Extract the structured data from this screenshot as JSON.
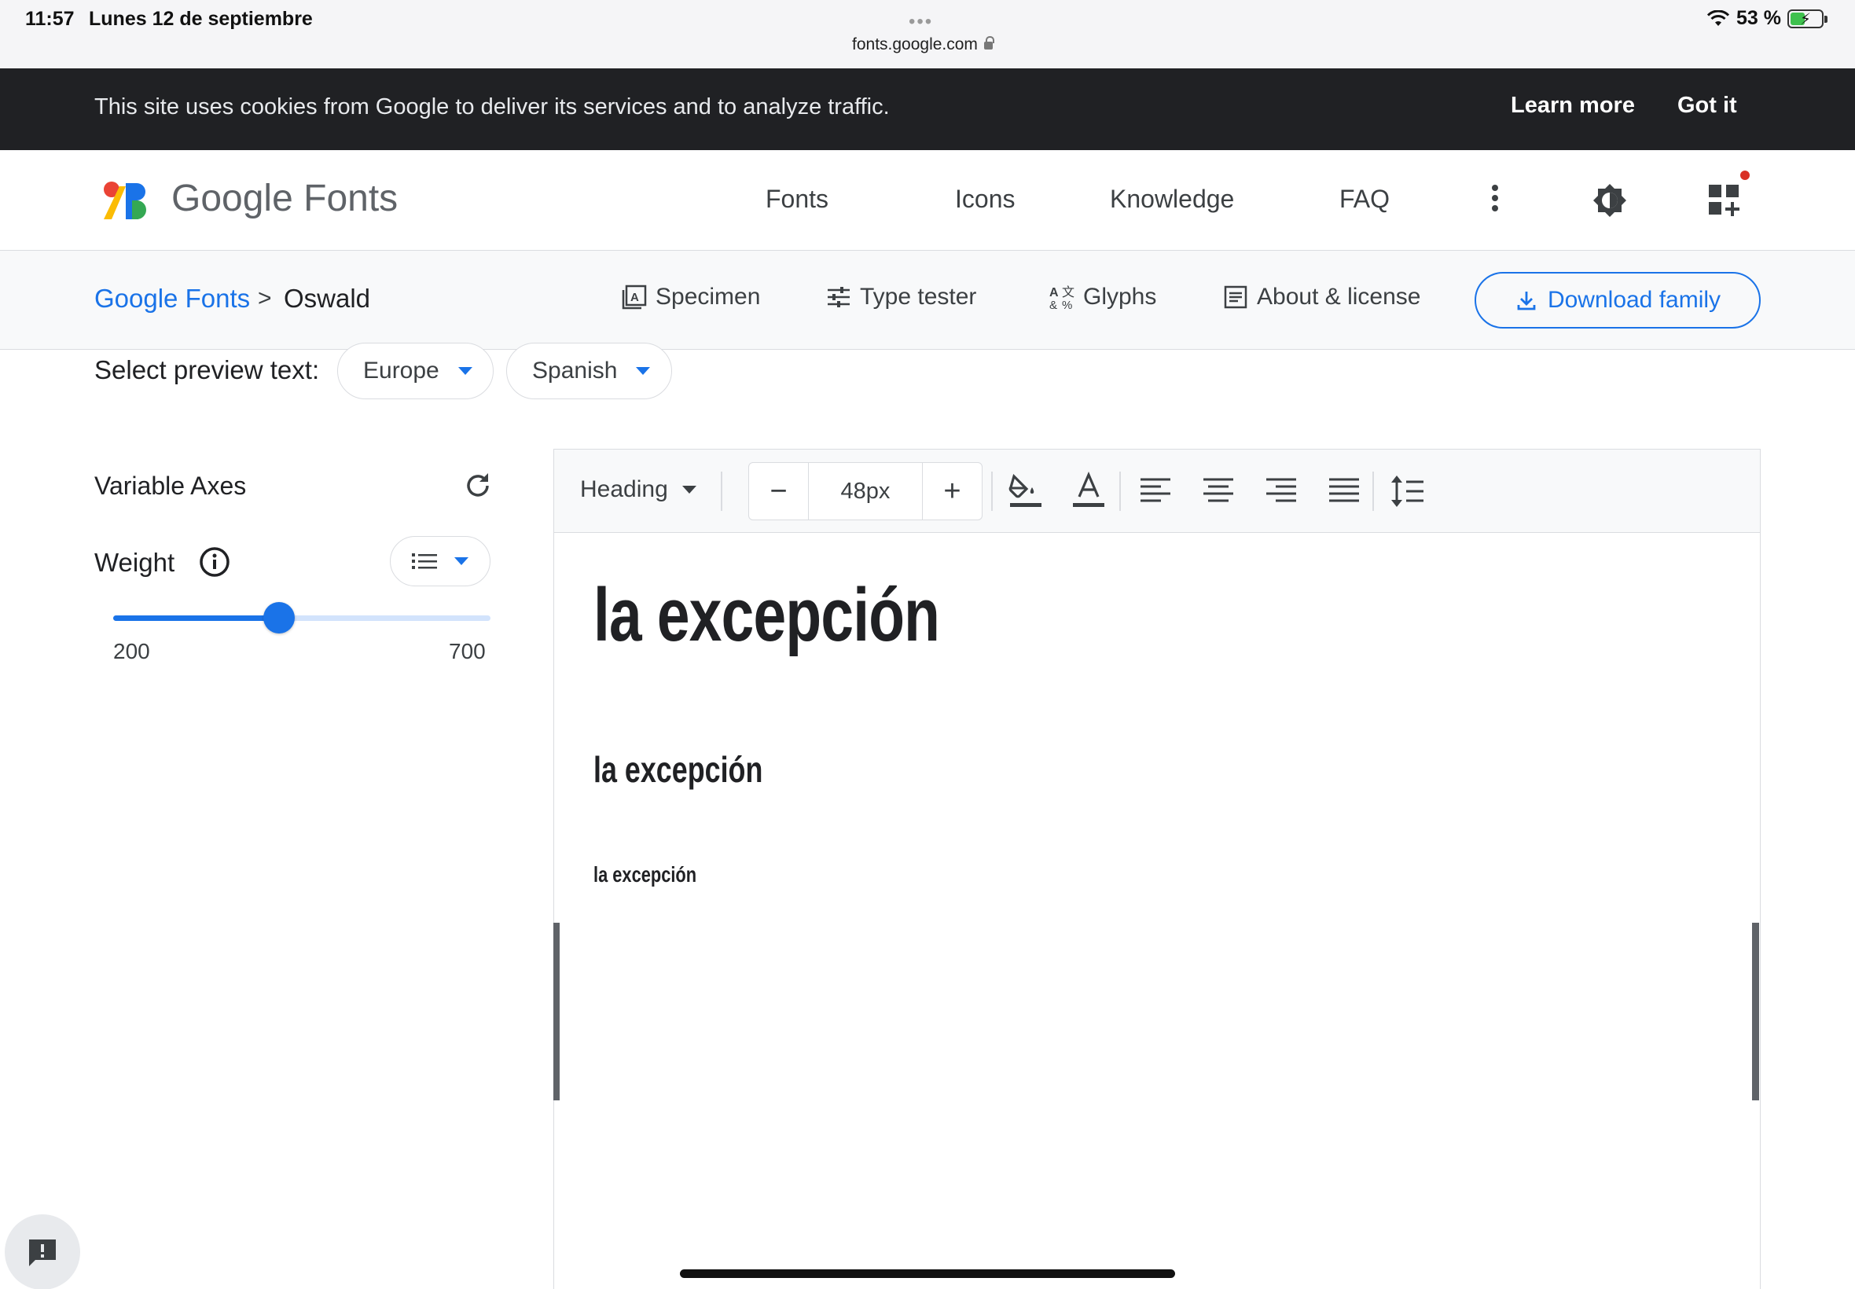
{
  "status_bar": {
    "time": "11:57",
    "date": "Lunes 12 de septiembre",
    "url": "fonts.google.com",
    "battery": "53 %",
    "battery_level": 0.53
  },
  "cookie_banner": {
    "text": "This site uses cookies from Google to deliver its services and to analyze traffic.",
    "learn_more": "Learn more",
    "got_it": "Got it"
  },
  "header": {
    "logo_text": "Google Fonts",
    "nav": [
      "Fonts",
      "Icons",
      "Knowledge",
      "FAQ"
    ],
    "icons": [
      "more-vert-icon",
      "theme-toggle-icon",
      "apps-add-icon"
    ]
  },
  "subnav": {
    "breadcrumb_root": "Google Fonts",
    "breadcrumb_sep": ">",
    "breadcrumb_current": "Oswald",
    "tabs": [
      "Specimen",
      "Type tester",
      "Glyphs",
      "About & license"
    ],
    "download": "Download family"
  },
  "preview_text": {
    "label": "Select preview text:",
    "region": "Europe",
    "language": "Spanish"
  },
  "axes": {
    "title": "Variable Axes",
    "weight_label": "Weight",
    "min": "200",
    "max": "700",
    "slider_fraction": 0.44
  },
  "toolbar": {
    "style": "Heading",
    "size": "48px",
    "minus": "−",
    "plus": "+"
  },
  "samples": [
    "la excepción",
    "la excepción",
    "la excepción"
  ],
  "colors": {
    "accent": "#1a73e8",
    "cookie_bg": "#202124",
    "text": "#202124"
  }
}
